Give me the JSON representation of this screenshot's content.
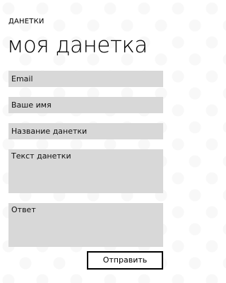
{
  "header": {
    "app_name": "ДАНЕТКИ",
    "title": "моя данетка"
  },
  "form": {
    "email_placeholder": "Email",
    "name_placeholder": "Ваше имя",
    "title_placeholder": "Название данетки",
    "text_placeholder": "Текст данетки",
    "answer_placeholder": "Ответ",
    "submit_label": "Отправить"
  }
}
